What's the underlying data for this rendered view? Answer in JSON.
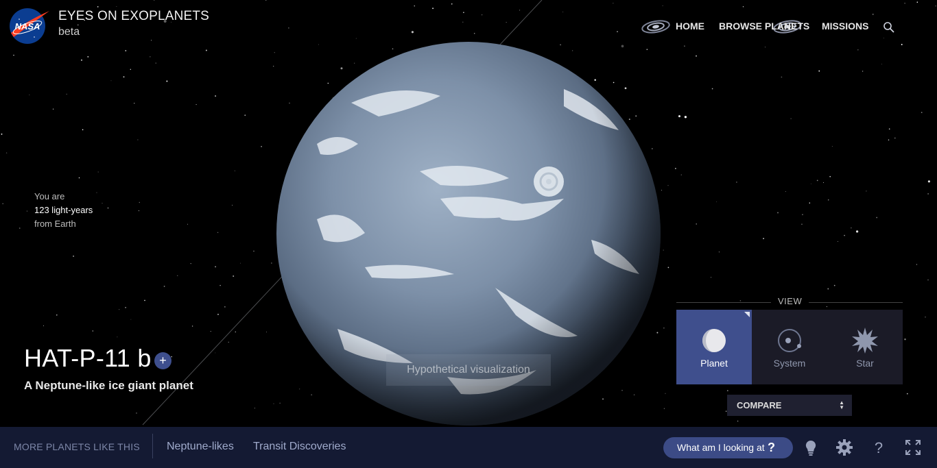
{
  "header": {
    "logo_text": "NASA",
    "title": "EYES ON EXOPLANETS",
    "subtitle": "beta"
  },
  "nav": {
    "items": [
      {
        "label": "HOME"
      },
      {
        "label": "BROWSE PLANETS"
      },
      {
        "label": "MISSIONS"
      }
    ],
    "icons": [
      "galaxy-icon",
      "search-icon"
    ]
  },
  "distance": {
    "line1": "You are",
    "line2": "123 light-years",
    "line3": "from Earth"
  },
  "planet": {
    "name": "HAT-P-11 b",
    "add_symbol": "+",
    "description": "A Neptune-like ice giant planet",
    "visualization_note": "Hypothetical visualization"
  },
  "view_panel": {
    "heading": "VIEW",
    "options": [
      {
        "label": "Planet",
        "icon": "planet-icon",
        "active": true
      },
      {
        "label": "System",
        "icon": "system-icon",
        "active": false
      },
      {
        "label": "Star",
        "icon": "star-icon",
        "active": false
      }
    ],
    "compare_label": "COMPARE"
  },
  "bottom_bar": {
    "more_label": "MORE PLANETS LIKE THIS",
    "tags": [
      "Neptune-likes",
      "Transit Discoveries"
    ],
    "looking_label": "What am I looking at",
    "looking_symbol": "?",
    "tool_icons": [
      "lightbulb-icon",
      "gear-icon",
      "help-icon",
      "fullscreen-icon"
    ]
  },
  "colors": {
    "accent": "#3f4f8d",
    "bottom_bar": "#141a33",
    "background": "#000000"
  }
}
